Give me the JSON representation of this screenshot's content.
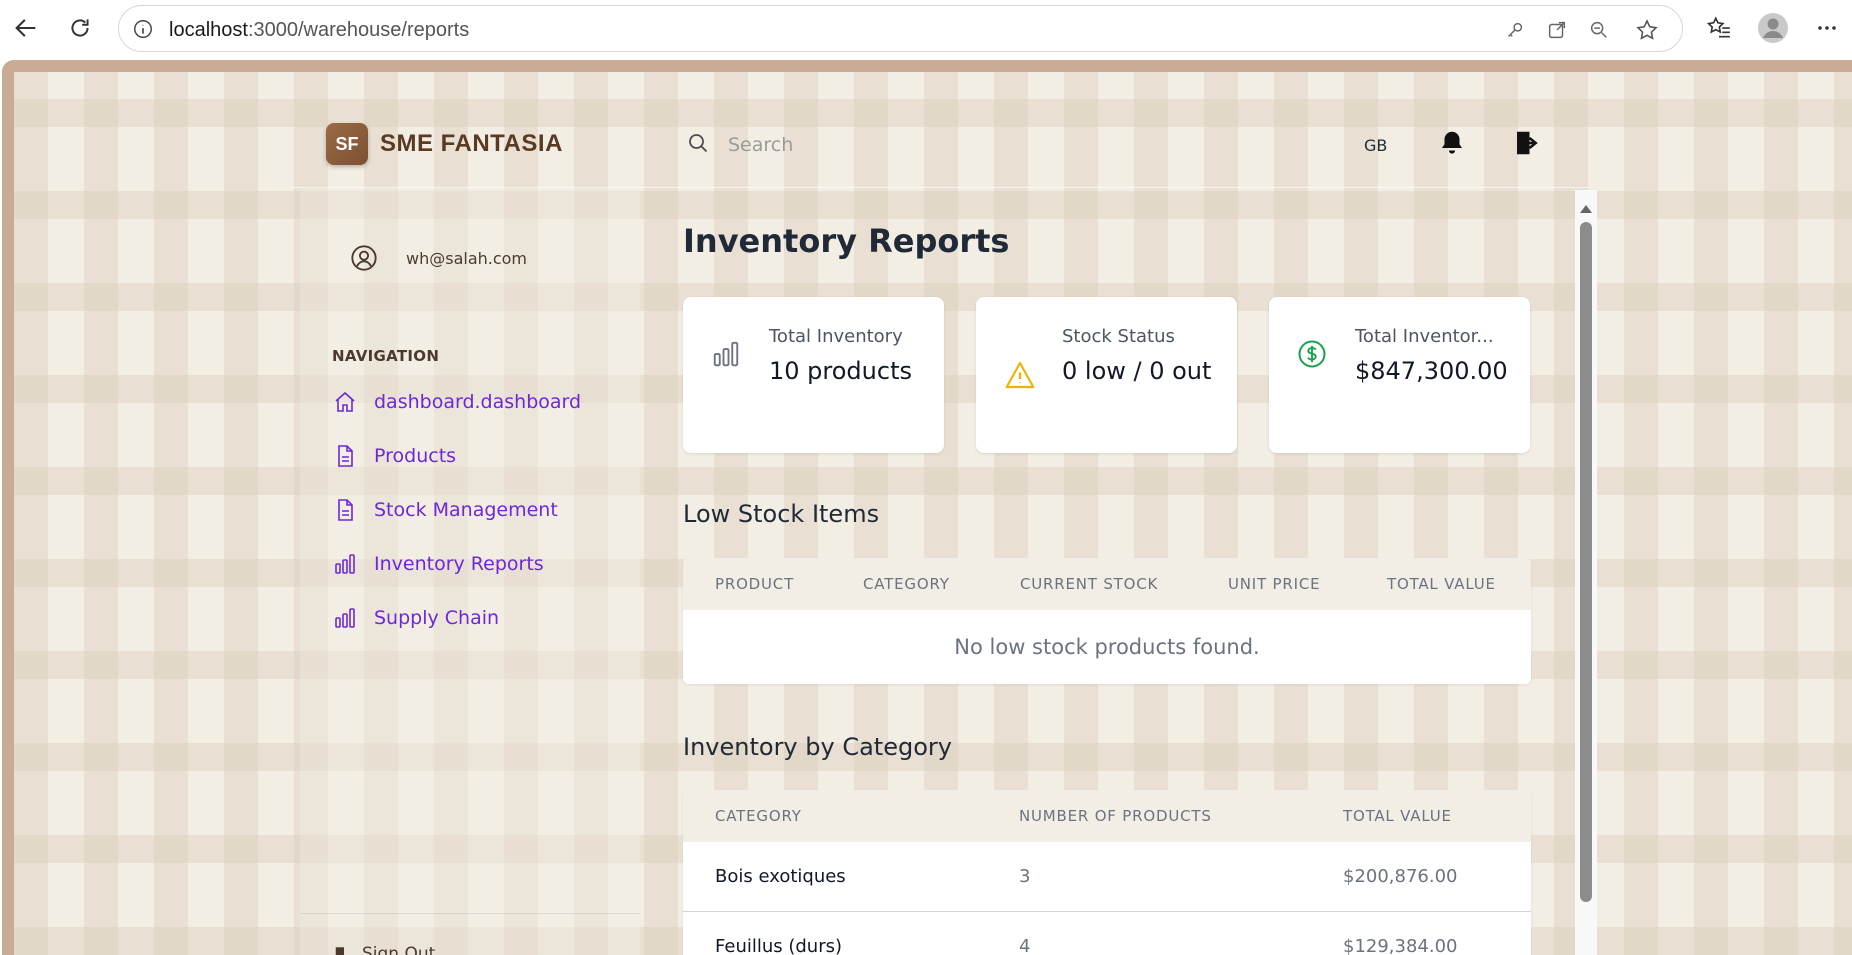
{
  "browser": {
    "url_host": "localhost",
    "url_path": ":3000/warehouse/reports"
  },
  "header": {
    "logo_initials": "SF",
    "brand": "SME FANTASIA",
    "search_placeholder": "Search",
    "language": "GB"
  },
  "sidebar": {
    "user_email": "wh@salah.com",
    "nav_title": "NAVIGATION",
    "items": [
      {
        "label": "dashboard.dashboard",
        "icon": "home-icon"
      },
      {
        "label": "Products",
        "icon": "document-icon"
      },
      {
        "label": "Stock Management",
        "icon": "document-icon"
      },
      {
        "label": "Inventory Reports",
        "icon": "bar-chart-icon"
      },
      {
        "label": "Supply Chain",
        "icon": "bar-chart-icon"
      }
    ],
    "signout_label": "Sign Out"
  },
  "main": {
    "title": "Inventory Reports",
    "cards": [
      {
        "label": "Total Inventory",
        "value": "10 products",
        "icon": "bar-chart-icon"
      },
      {
        "label": "Stock Status",
        "value": "0 low / 0 out",
        "icon": "warning-icon"
      },
      {
        "label": "Total Inventor...",
        "value": "$847,300.00",
        "icon": "dollar-icon"
      }
    ],
    "low_stock": {
      "title": "Low Stock Items",
      "columns": [
        "PRODUCT",
        "CATEGORY",
        "CURRENT STOCK",
        "UNIT PRICE",
        "TOTAL VALUE"
      ],
      "empty_message": "No low stock products found."
    },
    "by_category": {
      "title": "Inventory by Category",
      "columns": [
        "CATEGORY",
        "NUMBER OF PRODUCTS",
        "TOTAL VALUE"
      ],
      "rows": [
        {
          "category": "Bois exotiques",
          "count": "3",
          "value": "$200,876.00"
        },
        {
          "category": "Feuillus (durs)",
          "count": "4",
          "value": "$129,384.00"
        }
      ]
    }
  },
  "colors": {
    "accent": "#6d28d9",
    "brand": "#5a3a22",
    "background": "#f3eee4",
    "frame": "#c8ad94"
  }
}
